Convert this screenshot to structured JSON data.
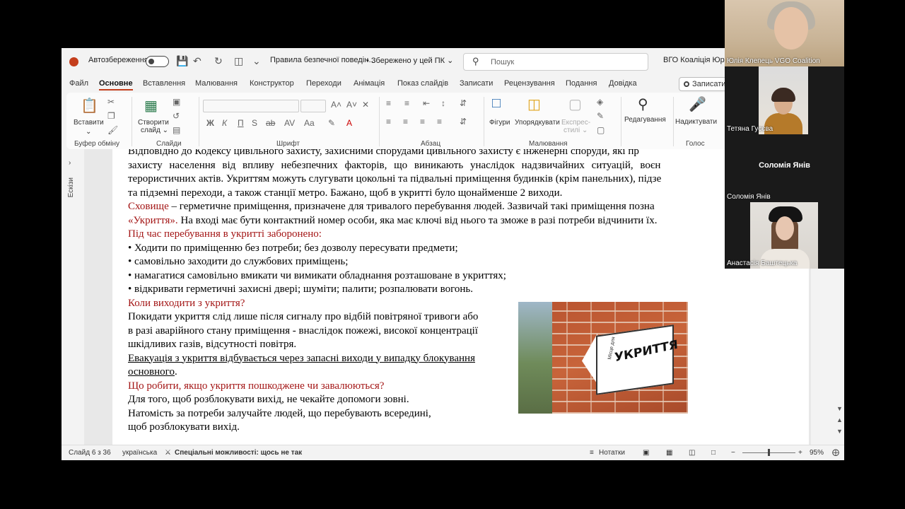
{
  "title_bar": {
    "autosave_label": "Автозбереження",
    "doc_title": "Правила безпечної поведін…",
    "save_state": "• Збережено у цей ПК ⌄",
    "search_placeholder": "Пошук",
    "org_name": "ВГО Коаліція Юрос"
  },
  "tabs": [
    "Файл",
    "Основне",
    "Вставлення",
    "Малювання",
    "Конструктор",
    "Переходи",
    "Анімація",
    "Показ слайдів",
    "Записати",
    "Рецензування",
    "Подання",
    "Довідка"
  ],
  "record_button": "Записати",
  "ribbon": {
    "paste": "Вставити",
    "new_slide": "Створити",
    "new_slide2": "слайд ⌄",
    "shapes": "Фігури",
    "arrange": "Упорядкувати",
    "quick_styles1": "Експрес-",
    "quick_styles2": "стилі ⌄",
    "editing": "Редагування",
    "dictate": "Надиктувати",
    "groups": {
      "clipboard": "Буфер обміну",
      "slides": "Слайди",
      "font": "Шрифт",
      "paragraph": "Абзац",
      "drawing": "Малювання",
      "voice": "Голос"
    }
  },
  "left_strip": {
    "label": "Ескізи"
  },
  "slide": {
    "l1": "Відповідно до Кодексу цивільного захисту, захисними спорудами цивільного захисту є інженерні споруди, які пр",
    "l2": "захисту населення від впливу небезпечних факторів, що виникають унаслідок надзвичайних ситуацій, воєн",
    "l3": "терористичних актів. Укриттям можуть слугувати цокольні та підвальні приміщення будинків (крім панельних), підзе",
    "l4": "та підземні переходи, а також станції метро. Бажано, щоб в укритті було щонайменше 2 виходи.",
    "l5_red": "Сховище",
    "l5_rest": " – герметичне приміщення, призначене для тривалого перебування людей. Зазвичай такі приміщення позна",
    "l6_red": "«Укриття».",
    "l6_rest": " На вході має бути контактний номер особи, яка має ключі від нього та зможе в разі потреби відчинити їх.",
    "h1": "Під час перебування в укритті заборонено:",
    "b1": "• Ходити по приміщенню без потреби;  без дозволу пересувати предмети;",
    "b2": "• самовільно заходити до службових приміщень;",
    "b3": "• намагатися самовільно вмикати чи вимикати обладнання розташоване в укриттях;",
    "b4": "• відкривати герметичні захисні двері; шуміти; палити; розпалювати вогонь.",
    "h2": "Коли виходити з укриття?",
    "p1": "Покидати укриття слід лише після сигналу про відбій повітряної тривоги або",
    "p2": "в разі аварійного стану приміщення - внаслідок пожежі, високої концентрації",
    "p3": "шкідливих газів, відсутності повітря.",
    "p4": "Евакуація з укриття відбувається через запасні виходи у випадку блокування",
    "p5": "основного",
    "p5_end": ".",
    "h3": "Що робити, якщо укриття пошкоджене чи завалюються?",
    "p6": "Для того, щоб розблокувати вихід, не чекайте допомоги зовні.",
    "p7": "Натомість за потреби залучайте людей, що перебувають всередині,",
    "p8": "щоб розблокувати вихід.",
    "image_sign": "УКРИТТЯ",
    "image_small": "Місце для"
  },
  "status_bar": {
    "slide_counter": "Слайд 6 з 36",
    "language": "українська",
    "accessibility": "Спеціальні можливості: щось не так",
    "notes": "Нотатки",
    "zoom": "95%"
  },
  "participants": [
    {
      "name": "Юлія Клепець VGO Coalition"
    },
    {
      "name": "Тетяна Гусєва"
    },
    {
      "name": "Соломія Янів",
      "center_label": "Соломія Янів"
    },
    {
      "name": "Анастасія Баштецька"
    }
  ],
  "colors": {
    "accent": "#c43e1c",
    "heading_red": "#a31515"
  }
}
